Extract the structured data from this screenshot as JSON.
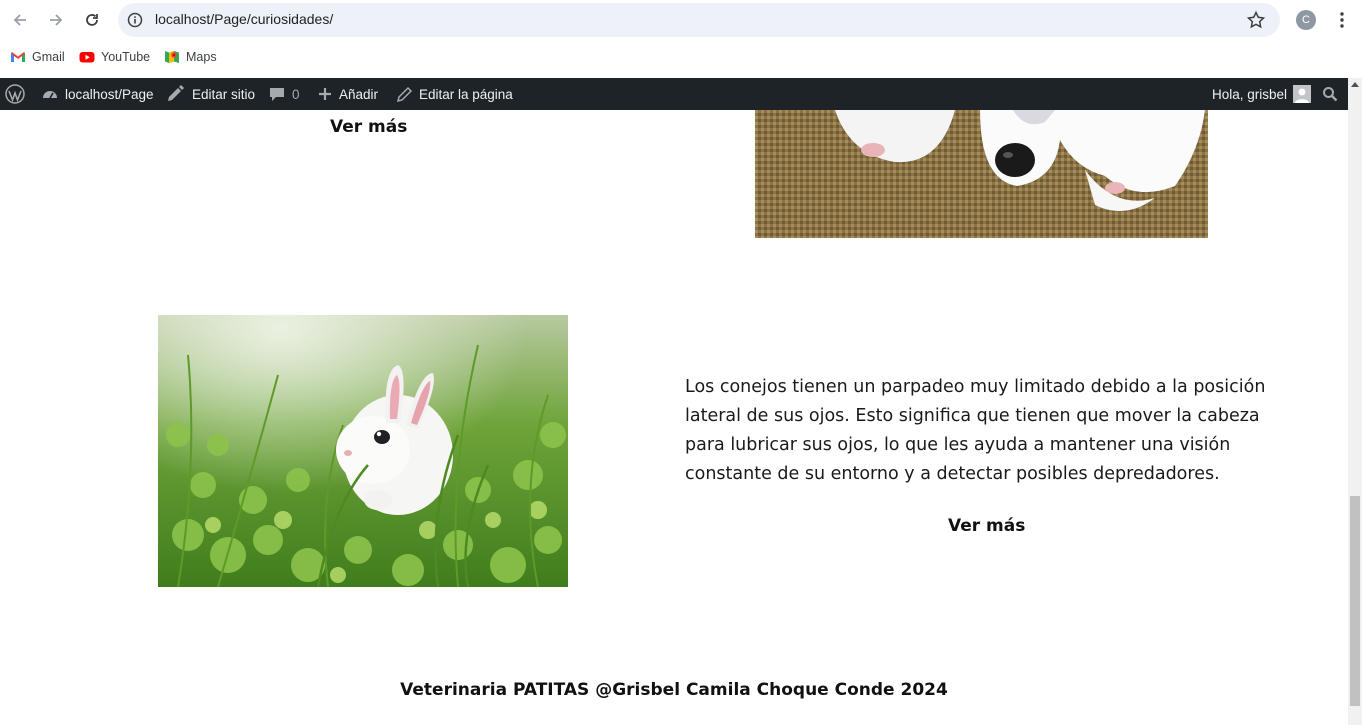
{
  "browser": {
    "url": "localhost/Page/curiosidades/",
    "profile_initial": "C",
    "bookmarks": [
      {
        "label": "Gmail",
        "icon": "gmail-icon"
      },
      {
        "label": "YouTube",
        "icon": "youtube-icon"
      },
      {
        "label": "Maps",
        "icon": "maps-icon"
      }
    ]
  },
  "wpbar": {
    "site": "localhost/Page",
    "edit_site": "Editar sitio",
    "comments": "0",
    "add": "Añadir",
    "edit_page": "Editar la página",
    "greeting": "Hola, grisbel"
  },
  "main": {
    "top_ver_mas": "Ver más",
    "rabbit_text": "Los conejos tienen un parpadeo muy limitado debido a la posición lateral de sus ojos. Esto significa que tienen que mover la cabeza para lubricar sus ojos, lo que les ayuda a mantener una visión constante de su entorno y a detectar posibles depredadores.",
    "rabbit_ver_mas": "Ver más",
    "footer": "Veterinaria PATITAS @Grisbel Camila Choque Conde 2024"
  },
  "colors": {
    "wp_bar": "#1d2327",
    "address_bar": "#eef1f7"
  }
}
